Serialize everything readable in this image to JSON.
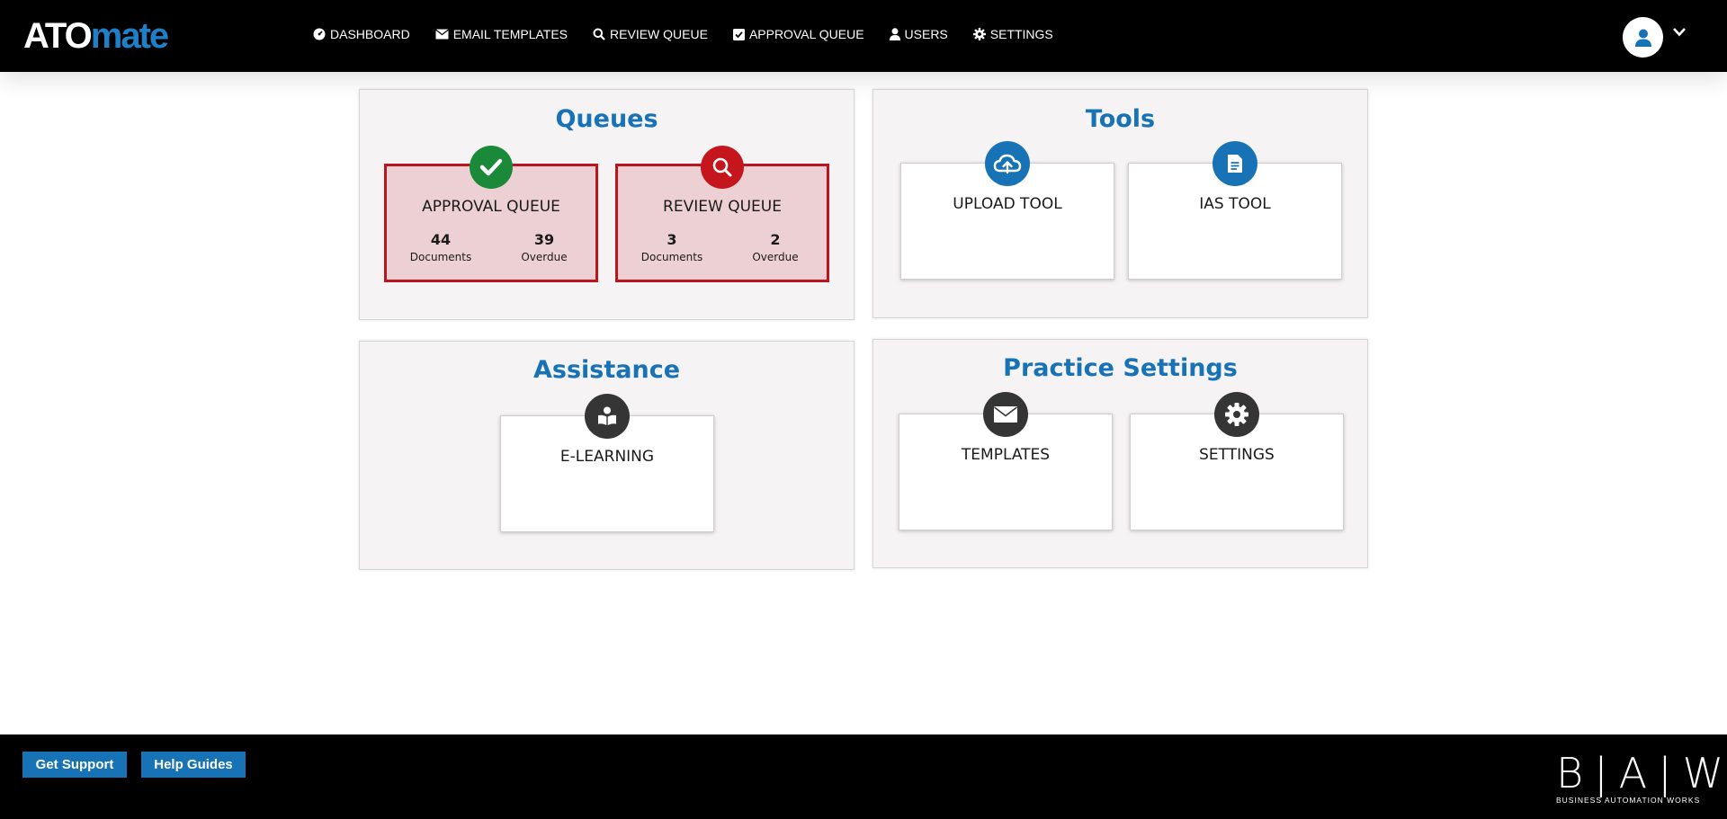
{
  "brand": {
    "logo_part1": "ATO",
    "logo_part2": "mate",
    "colors": {
      "primary": "#1872b6",
      "header": "#000000"
    }
  },
  "nav": {
    "items": [
      {
        "label": "DASHBOARD",
        "icon": "dashboard-gauge-icon"
      },
      {
        "label": "EMAIL TEMPLATES",
        "icon": "envelope-icon"
      },
      {
        "label": "REVIEW QUEUE",
        "icon": "search-icon"
      },
      {
        "label": "APPROVAL QUEUE",
        "icon": "check-square-icon"
      },
      {
        "label": "USERS",
        "icon": "user-icon"
      },
      {
        "label": "SETTINGS",
        "icon": "gear-icon"
      }
    ]
  },
  "queues": {
    "title": "Queues",
    "approval": {
      "label": "APPROVAL QUEUE",
      "documents": "44",
      "documents_label": "Documents",
      "overdue": "39",
      "overdue_label": "Overdue",
      "icon": "check-icon",
      "color": "#1a8a3a"
    },
    "review": {
      "label": "REVIEW QUEUE",
      "documents": "3",
      "documents_label": "Documents",
      "overdue": "2",
      "overdue_label": "Overdue",
      "icon": "search-icon",
      "color": "#c4161c"
    }
  },
  "tools": {
    "title": "Tools",
    "upload": {
      "label": "UPLOAD TOOL",
      "icon": "cloud-upload-icon"
    },
    "ias": {
      "label": "IAS TOOL",
      "icon": "document-icon"
    }
  },
  "assistance": {
    "title": "Assistance",
    "elearning": {
      "label": "E-LEARNING",
      "icon": "book-reader-icon"
    }
  },
  "practice_settings": {
    "title": "Practice Settings",
    "templates": {
      "label": "TEMPLATES",
      "icon": "envelope-icon"
    },
    "settings": {
      "label": "SETTINGS",
      "icon": "gear-icon"
    }
  },
  "footer": {
    "get_support": "Get Support",
    "help_guides": "Help Guides",
    "baw_mark": "B|A|W",
    "baw_text": "BUSINESS AUTOMATION WORKS"
  }
}
